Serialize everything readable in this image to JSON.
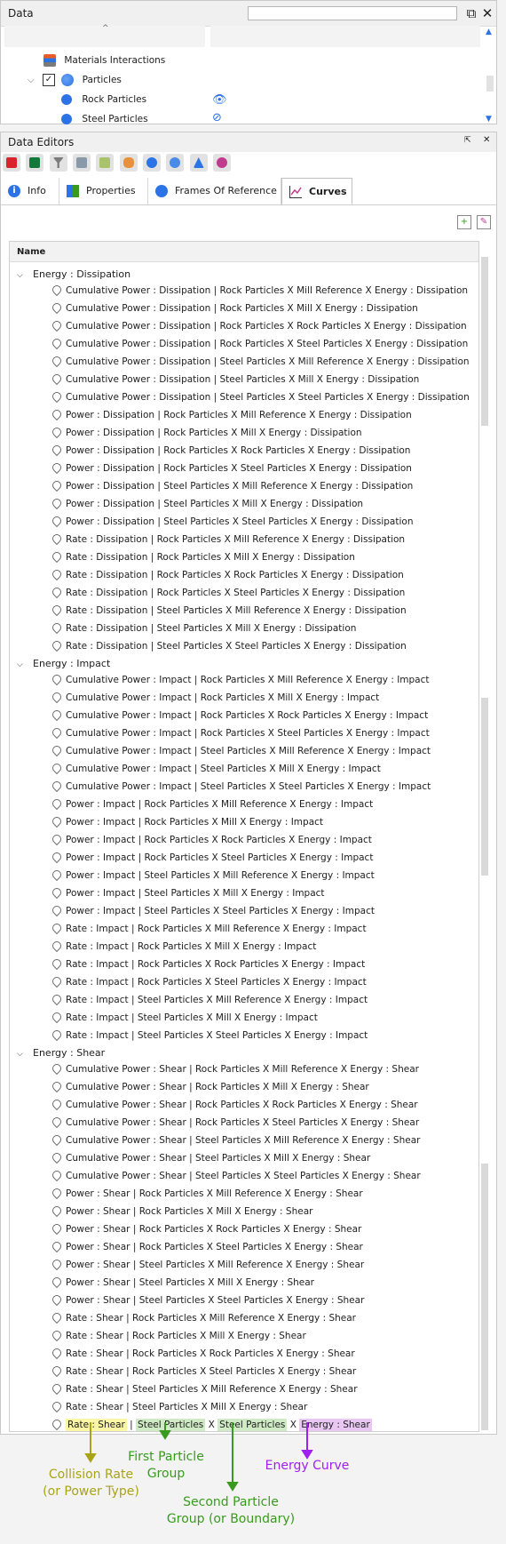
{
  "data_panel": {
    "title": "Data",
    "search_value": "",
    "items": [
      {
        "label": "Materials Interactions"
      },
      {
        "label": "Particles"
      },
      {
        "label": "Rock Particles"
      },
      {
        "label": "Steel Particles"
      }
    ]
  },
  "editors": {
    "title": "Data Editors",
    "tabs": [
      {
        "label": "Info"
      },
      {
        "label": "Properties"
      },
      {
        "label": "Frames Of Reference"
      },
      {
        "label": "Curves"
      }
    ],
    "column_name": "Name",
    "groups": [
      {
        "label": "Energy : Dissipation",
        "items": [
          "Cumulative Power : Dissipation | Rock Particles X Mill Reference X Energy : Dissipation",
          "Cumulative Power : Dissipation | Rock Particles X Mill X Energy : Dissipation",
          "Cumulative Power : Dissipation | Rock Particles X Rock Particles X Energy : Dissipation",
          "Cumulative Power : Dissipation | Rock Particles X Steel Particles X Energy : Dissipation",
          "Cumulative Power : Dissipation | Steel Particles X Mill Reference X Energy : Dissipation",
          "Cumulative Power : Dissipation | Steel Particles X Mill X Energy : Dissipation",
          "Cumulative Power : Dissipation | Steel Particles X Steel Particles X Energy : Dissipation",
          "Power : Dissipation | Rock Particles X Mill Reference X Energy : Dissipation",
          "Power : Dissipation | Rock Particles X Mill X Energy : Dissipation",
          "Power : Dissipation | Rock Particles X Rock Particles X Energy : Dissipation",
          "Power : Dissipation | Rock Particles X Steel Particles X Energy : Dissipation",
          "Power : Dissipation | Steel Particles X Mill Reference X Energy : Dissipation",
          "Power : Dissipation | Steel Particles X Mill X Energy : Dissipation",
          "Power : Dissipation | Steel Particles X Steel Particles X Energy : Dissipation",
          "Rate : Dissipation | Rock Particles X Mill Reference X Energy : Dissipation",
          "Rate : Dissipation | Rock Particles X Mill X Energy : Dissipation",
          "Rate : Dissipation | Rock Particles X Rock Particles X Energy : Dissipation",
          "Rate : Dissipation | Rock Particles X Steel Particles X Energy : Dissipation",
          "Rate : Dissipation | Steel Particles X Mill Reference X Energy : Dissipation",
          "Rate : Dissipation | Steel Particles X Mill X Energy : Dissipation",
          "Rate : Dissipation | Steel Particles X Steel Particles X Energy : Dissipation"
        ]
      },
      {
        "label": "Energy : Impact",
        "items": [
          "Cumulative Power : Impact | Rock Particles X Mill Reference X Energy : Impact",
          "Cumulative Power : Impact | Rock Particles X Mill X Energy : Impact",
          "Cumulative Power : Impact | Rock Particles X Rock Particles X Energy : Impact",
          "Cumulative Power : Impact | Rock Particles X Steel Particles X Energy : Impact",
          "Cumulative Power : Impact | Steel Particles X Mill Reference X Energy : Impact",
          "Cumulative Power : Impact | Steel Particles X Mill X Energy : Impact",
          "Cumulative Power : Impact | Steel Particles X Steel Particles X Energy : Impact",
          "Power : Impact | Rock Particles X Mill Reference X Energy : Impact",
          "Power : Impact | Rock Particles X Mill X Energy : Impact",
          "Power : Impact | Rock Particles X Rock Particles X Energy : Impact",
          "Power : Impact | Rock Particles X Steel Particles X Energy : Impact",
          "Power : Impact | Steel Particles X Mill Reference X Energy : Impact",
          "Power : Impact | Steel Particles X Mill X Energy : Impact",
          "Power : Impact | Steel Particles X Steel Particles X Energy : Impact",
          "Rate : Impact | Rock Particles X Mill Reference X Energy : Impact",
          "Rate : Impact | Rock Particles X Mill X Energy : Impact",
          "Rate : Impact | Rock Particles X Rock Particles X Energy : Impact",
          "Rate : Impact | Rock Particles X Steel Particles X Energy : Impact",
          "Rate : Impact | Steel Particles X Mill Reference X Energy : Impact",
          "Rate : Impact | Steel Particles X Mill X Energy : Impact",
          "Rate : Impact | Steel Particles X Steel Particles X Energy : Impact"
        ]
      },
      {
        "label": "Energy : Shear",
        "items": [
          "Cumulative Power : Shear | Rock Particles X Mill Reference X Energy : Shear",
          "Cumulative Power : Shear | Rock Particles X Mill X Energy : Shear",
          "Cumulative Power : Shear | Rock Particles X Rock Particles X Energy : Shear",
          "Cumulative Power : Shear | Rock Particles X Steel Particles X Energy : Shear",
          "Cumulative Power : Shear | Steel Particles X Mill Reference X Energy : Shear",
          "Cumulative Power : Shear | Steel Particles X Mill X Energy : Shear",
          "Cumulative Power : Shear | Steel Particles X Steel Particles X Energy : Shear",
          "Power : Shear | Rock Particles X Mill Reference X Energy : Shear",
          "Power : Shear | Rock Particles X Mill X Energy : Shear",
          "Power : Shear | Rock Particles X Rock Particles X Energy : Shear",
          "Power : Shear | Rock Particles X Steel Particles X Energy : Shear",
          "Power : Shear | Steel Particles X Mill Reference X Energy : Shear",
          "Power : Shear | Steel Particles X Mill X Energy : Shear",
          "Power : Shear | Steel Particles X Steel Particles X Energy : Shear",
          "Rate : Shear | Rock Particles X Mill Reference X Energy : Shear",
          "Rate : Shear | Rock Particles X Mill X Energy : Shear",
          "Rate : Shear | Rock Particles X Rock Particles X Energy : Shear",
          "Rate : Shear | Rock Particles X Steel Particles X Energy : Shear",
          "Rate : Shear | Steel Particles X Mill Reference X Energy : Shear",
          "Rate : Shear | Steel Particles X Mill X Energy : Shear"
        ]
      }
    ],
    "last_item": {
      "part1": "Rate : Shear",
      "sep1": " | ",
      "part2": "Steel Particles",
      "sep2": " X ",
      "part3": "Steel Particles",
      "sep3": " X ",
      "part4": "Energy : Shear"
    }
  },
  "annotations": {
    "collision_rate": "Collision Rate\n(or Power Type)",
    "first_group": "First Particle\nGroup",
    "second_group": "Second Particle\nGroup (or Boundary)",
    "energy_curve": "Energy Curve",
    "colors": {
      "yellow": "#a9a317",
      "green": "#3a9a1f",
      "purple": "#a020f0"
    }
  }
}
